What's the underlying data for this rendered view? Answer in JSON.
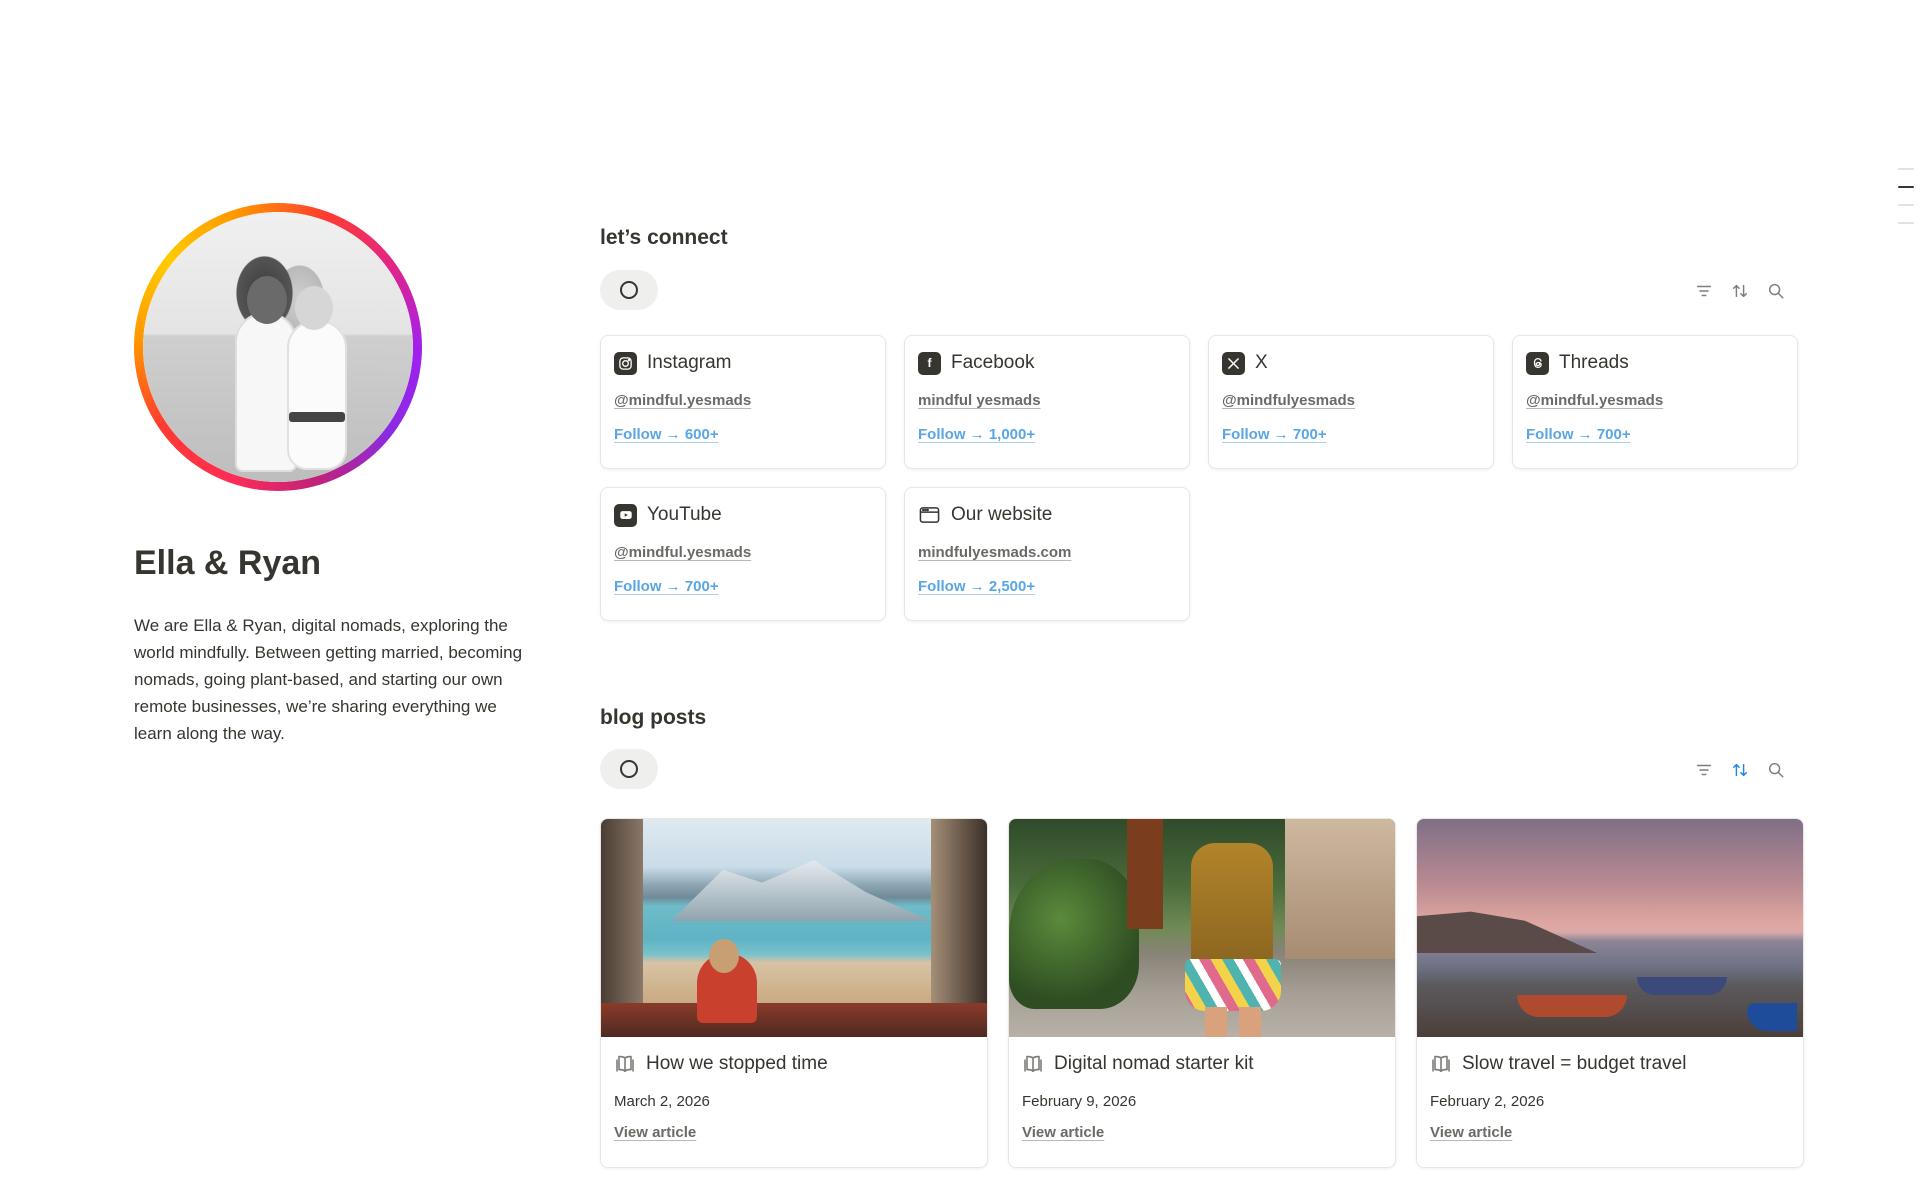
{
  "profile": {
    "name": "Ella & Ryan",
    "bio": "We are Ella & Ryan, digital nomads, exploring the world mindfully. Between getting married, becoming nomads, going plant-based, and starting our own remote businesses, we’re sharing everything we learn along the way."
  },
  "connect": {
    "title": "let’s connect",
    "cards": [
      {
        "title": "Instagram",
        "icon": "instagram-icon",
        "handle": "@mindful.yesmads",
        "follow": "Follow → 600+"
      },
      {
        "title": "Facebook",
        "icon": "facebook-icon",
        "handle": "mindful yesmads",
        "follow": "Follow → 1,000+"
      },
      {
        "title": "X",
        "icon": "x-icon",
        "handle": "@mindfulyesmads",
        "follow": "Follow → 700+"
      },
      {
        "title": "Threads",
        "icon": "threads-icon",
        "handle": "@mindful.yesmads",
        "follow": "Follow → 700+"
      },
      {
        "title": "YouTube",
        "icon": "youtube-icon",
        "handle": "@mindful.yesmads",
        "follow": "Follow → 700+"
      },
      {
        "title": "Our website",
        "icon": "browser-window-icon",
        "handle": "mindfulyesmads.com",
        "follow": "Follow → 2,500+"
      }
    ]
  },
  "blog": {
    "title": "blog posts",
    "posts": [
      {
        "title": "How we stopped time",
        "date": "March 2, 2026",
        "link": "View article"
      },
      {
        "title": "Digital nomad starter kit",
        "date": "February 9, 2026",
        "link": "View article"
      },
      {
        "title": "Slow travel = budget travel",
        "date": "February 2, 2026",
        "link": "View article"
      }
    ]
  },
  "colors": {
    "text": "#37352f",
    "muted": "#6b6a66",
    "link_blue": "#5aa5e3",
    "active_tool": "#2383e2",
    "border": "#e8e7e4"
  }
}
